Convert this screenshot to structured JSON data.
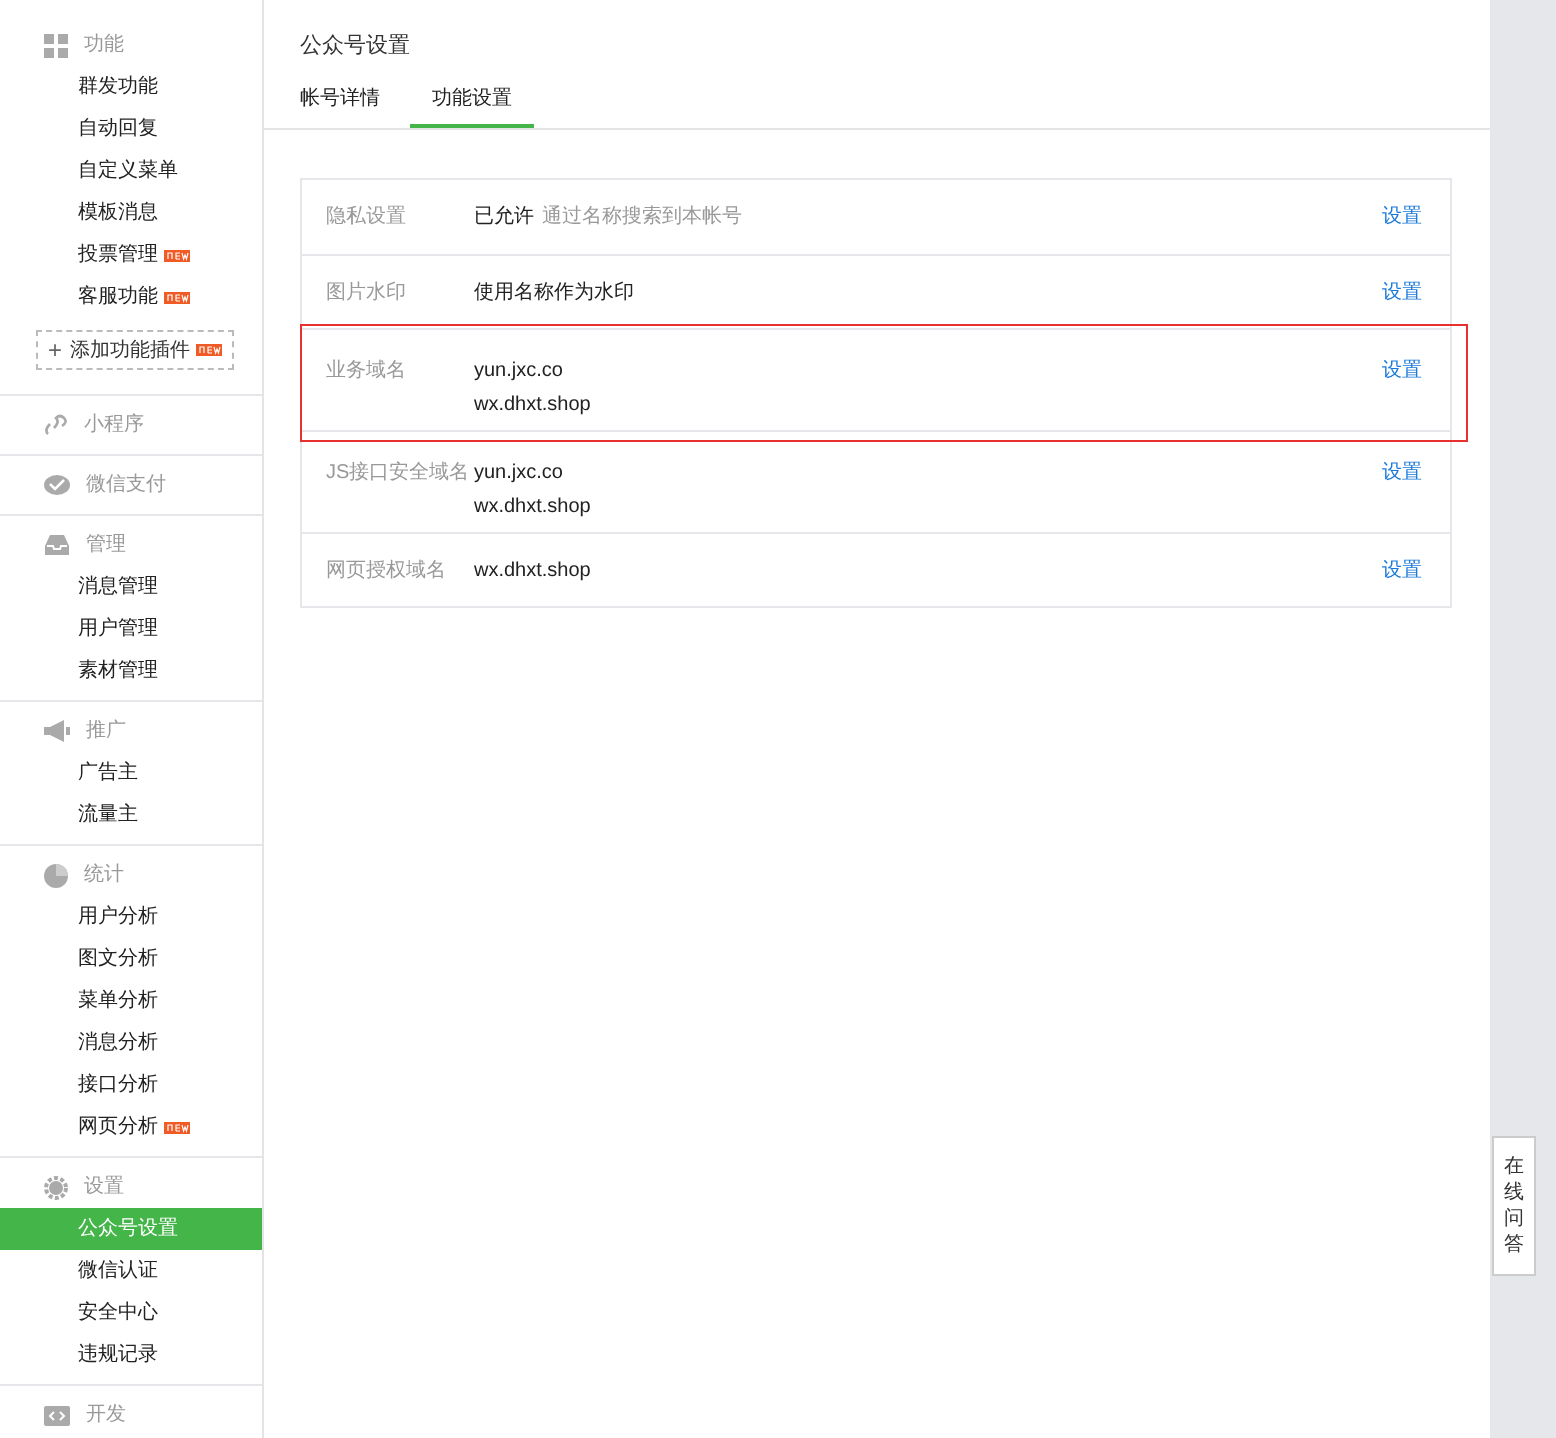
{
  "sidebar": {
    "groups": [
      {
        "title": "功能",
        "items": [
          {
            "label": "群发功能",
            "selected": false,
            "badge": false
          },
          {
            "label": "自动回复",
            "selected": false,
            "badge": false
          },
          {
            "label": "自定义菜单",
            "selected": false,
            "badge": false
          },
          {
            "label": "模板消息",
            "selected": false,
            "badge": false
          },
          {
            "label": "投票管理",
            "selected": false,
            "badge": true
          },
          {
            "label": "客服功能",
            "selected": false,
            "badge": true
          }
        ],
        "add_button": {
          "icon": "+",
          "label": "添加功能插件",
          "badge": true
        }
      },
      {
        "title": "小程序"
      },
      {
        "title": "微信支付"
      },
      {
        "title": "管理",
        "items": [
          {
            "label": "消息管理",
            "selected": false,
            "badge": false
          },
          {
            "label": "用户管理",
            "selected": false,
            "badge": false
          },
          {
            "label": "素材管理",
            "selected": false,
            "badge": false
          }
        ]
      },
      {
        "title": "推广",
        "items": [
          {
            "label": "广告主",
            "selected": false,
            "badge": false
          },
          {
            "label": "流量主",
            "selected": false,
            "badge": false
          }
        ]
      },
      {
        "title": "统计",
        "items": [
          {
            "label": "用户分析",
            "selected": false,
            "badge": false
          },
          {
            "label": "图文分析",
            "selected": false,
            "badge": false
          },
          {
            "label": "菜单分析",
            "selected": false,
            "badge": false
          },
          {
            "label": "消息分析",
            "selected": false,
            "badge": false
          },
          {
            "label": "接口分析",
            "selected": false,
            "badge": false
          },
          {
            "label": "网页分析",
            "selected": false,
            "badge": true
          }
        ]
      },
      {
        "title": "设置",
        "items": [
          {
            "label": "公众号设置",
            "selected": true,
            "badge": false
          },
          {
            "label": "微信认证",
            "selected": false,
            "badge": false
          },
          {
            "label": "安全中心",
            "selected": false,
            "badge": false
          },
          {
            "label": "违规记录",
            "selected": false,
            "badge": false
          }
        ]
      },
      {
        "title": "开发"
      }
    ]
  },
  "page": {
    "title": "公众号设置",
    "tabs": [
      {
        "label": "帐号详情",
        "selected": false
      },
      {
        "label": "功能设置",
        "selected": true
      }
    ]
  },
  "settings": [
    {
      "label": "隐私设置",
      "values": [
        "已允许"
      ],
      "note": "通过名称搜索到本帐号",
      "action": "设置",
      "highlighted": false
    },
    {
      "label": "图片水印",
      "values": [
        "使用名称作为水印"
      ],
      "action": "设置",
      "highlighted": false
    },
    {
      "label": "业务域名",
      "values": [
        "yun.jxc.co",
        "wx.dhxt.shop"
      ],
      "action": "设置",
      "highlighted": true
    },
    {
      "label": "JS接口安全域名",
      "values": [
        "yun.jxc.co",
        "wx.dhxt.shop"
      ],
      "action": "设置",
      "highlighted": false
    },
    {
      "label": "网页授权域名",
      "values": [
        "wx.dhxt.shop"
      ],
      "action": "设置",
      "highlighted": false
    }
  ],
  "help_tab": "在线问答"
}
